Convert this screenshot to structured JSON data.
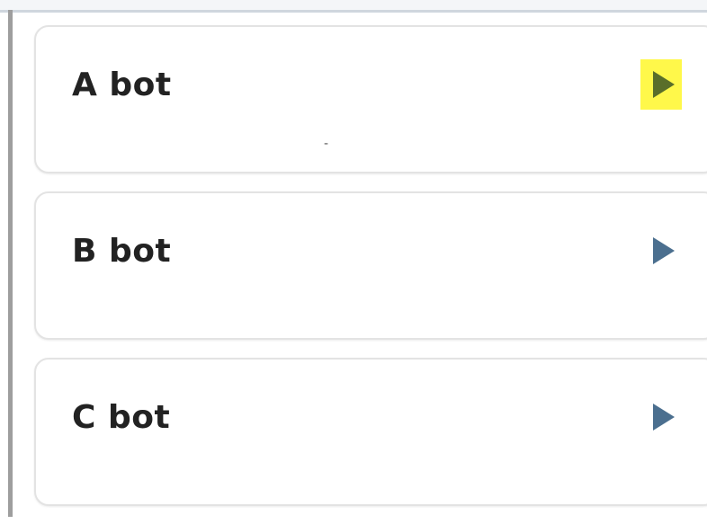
{
  "bots": [
    {
      "name": "A bot",
      "highlighted": true,
      "extra_text": "-"
    },
    {
      "name": "B bot",
      "highlighted": false,
      "extra_text": ""
    },
    {
      "name": "C bot",
      "highlighted": false,
      "extra_text": ""
    }
  ],
  "colors": {
    "play_icon": "#4b6f8f",
    "play_icon_highlighted": "#5a6e2a",
    "highlight_bg": "#fff84a",
    "card_border": "#e3e3e3",
    "left_border": "#9e9e9e"
  }
}
